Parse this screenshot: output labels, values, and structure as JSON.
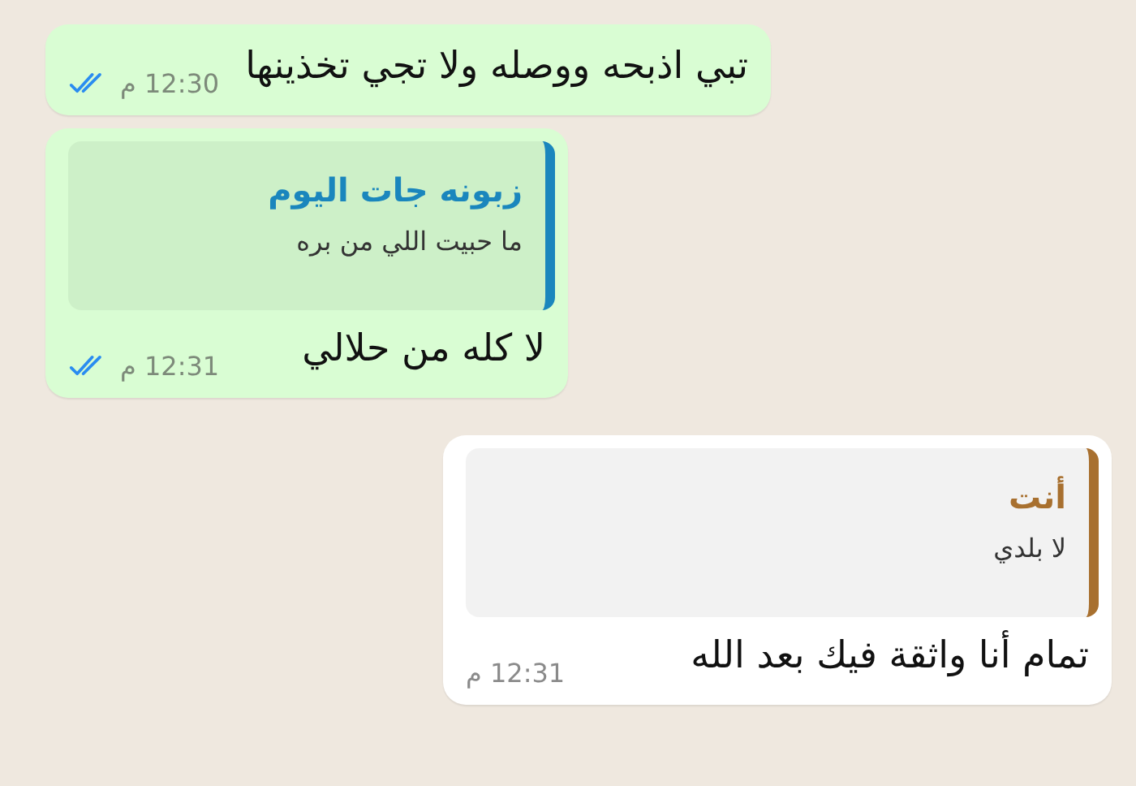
{
  "messages": [
    {
      "kind": "sent",
      "text": "تبي اذبحه ووصله ولا تجي تخذينها",
      "time": "12:30 م",
      "read": true
    },
    {
      "kind": "sent",
      "quote": {
        "sender": "زبونه جات اليوم",
        "text": "ما حبيت اللي من بره",
        "color": "#1a86bd"
      },
      "text": "لا كله من حلالي",
      "time": "12:31 م",
      "read": true
    },
    {
      "kind": "received",
      "quote": {
        "sender": "أنت",
        "text": "لا بلدي",
        "color": "#a8702f"
      },
      "text": "تمام أنا واثقة فيك بعد الله",
      "time": "12:31 م"
    }
  ]
}
